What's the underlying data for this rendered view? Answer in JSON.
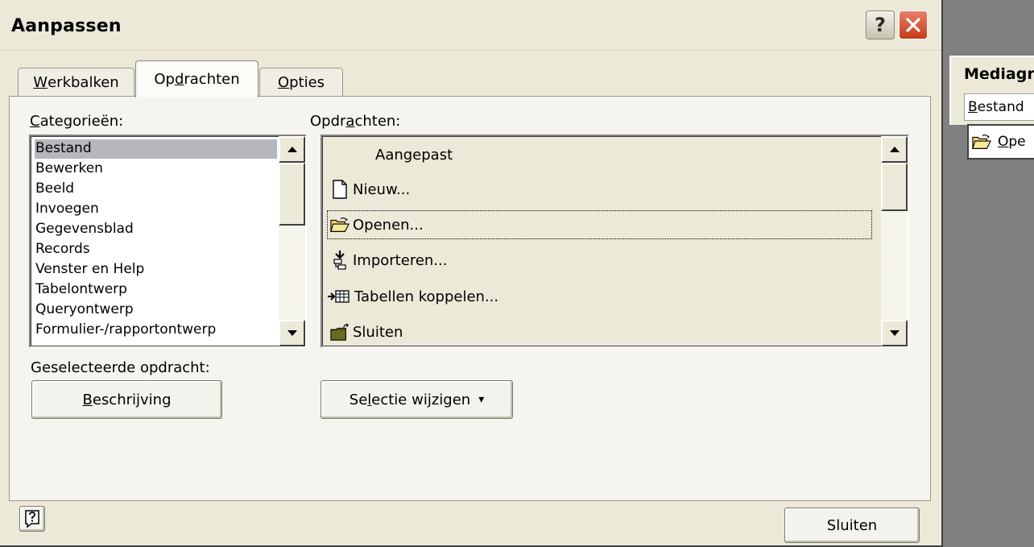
{
  "dialog": {
    "title": "Aanpassen",
    "title_buttons": {
      "help": "?"
    },
    "tabs": [
      {
        "label_u": "W",
        "label_rest": "erkbalken"
      },
      {
        "label_pre": "Op",
        "label_u": "d",
        "label_rest": "rachten"
      },
      {
        "label_u": "O",
        "label_rest": "pties"
      }
    ],
    "categories_label_u": "C",
    "categories_label_rest": "ategorieën:",
    "categories": [
      "Bestand",
      "Bewerken",
      "Beeld",
      "Invoegen",
      "Gegevensblad",
      "Records",
      "Venster en Help",
      "Tabelontwerp",
      "Queryontwerp",
      "Formulier-/rapportontwerp"
    ],
    "commands_label_pre": "Opdr",
    "commands_label_u": "a",
    "commands_label_rest": "chten:",
    "commands": [
      {
        "label": "Aangepast",
        "icon": "none"
      },
      {
        "label": "Nieuw...",
        "icon": "new-document-icon"
      },
      {
        "label": "Openen...",
        "icon": "open-folder-icon"
      },
      {
        "label": "Importeren...",
        "icon": "import-icon"
      },
      {
        "label": "Tabellen koppelen...",
        "icon": "link-tables-icon"
      },
      {
        "label": "Sluiten",
        "icon": "close-folder-icon"
      }
    ],
    "selected_command_label": "Geselecteerde opdracht:",
    "description_button_u": "B",
    "description_button_rest": "eschrijving",
    "modify_selection_pre": "Se",
    "modify_selection_u": "l",
    "modify_selection_rest": "ectie wijzigen",
    "modify_selection_arrow": "▾",
    "close_button": "Sluiten"
  },
  "background_toolbar": {
    "title": "Mediagr",
    "menu_u": "B",
    "menu_rest": "estand",
    "submenu_u": "O",
    "submenu_rest": "pe"
  }
}
